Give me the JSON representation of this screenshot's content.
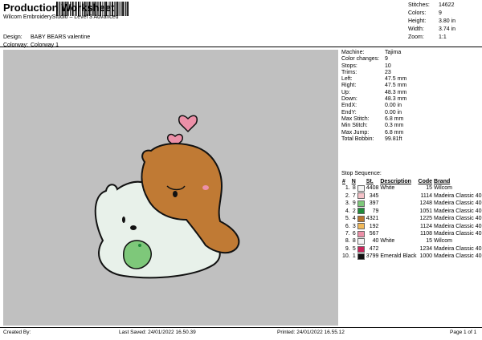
{
  "header": {
    "title": "Production Worksheet",
    "subtitle": "Wilcom EmbroideryStudio – Level 3 Advanced"
  },
  "stats": [
    {
      "label": "Stitches:",
      "value": "14622"
    },
    {
      "label": "Colors:",
      "value": "9"
    },
    {
      "label": "Height:",
      "value": "3.80 in"
    },
    {
      "label": "Width:",
      "value": "3.74 in"
    },
    {
      "label": "Zoom:",
      "value": "1:1"
    }
  ],
  "meta": [
    {
      "label": "Design:",
      "value": "BABY BEARS valentine"
    },
    {
      "label": "Colorway:",
      "value": "Colorway 1"
    }
  ],
  "machine_info": [
    {
      "label": "Machine:",
      "value": "Tajima"
    },
    {
      "label": "Color changes:",
      "value": "9"
    },
    {
      "label": "Stops:",
      "value": "10"
    },
    {
      "label": "Trims:",
      "value": "23"
    },
    {
      "label": "Left:",
      "value": "47.5 mm"
    },
    {
      "label": "Right:",
      "value": "47.5 mm"
    },
    {
      "label": "Up:",
      "value": "48.3 mm"
    },
    {
      "label": "Down:",
      "value": "48.3 mm"
    },
    {
      "label": "EndX:",
      "value": "0.00 in"
    },
    {
      "label": "EndY:",
      "value": "0.00 in"
    },
    {
      "label": "Max Stitch:",
      "value": "6.8 mm"
    },
    {
      "label": "Min Stitch:",
      "value": "0.3 mm"
    },
    {
      "label": "Max Jump:",
      "value": "6.8 mm"
    },
    {
      "label": "Total Bobbin:",
      "value": "99.81ft"
    }
  ],
  "sequence": {
    "heading": "Stop Sequence:",
    "columns": [
      "#",
      "N",
      "St.",
      "Description",
      "Code",
      "Brand"
    ],
    "rows": [
      {
        "num": "1.",
        "n": "8",
        "color": "#f4f4f4",
        "st": "4408",
        "desc": "White",
        "code": "15",
        "brand": "Wilcom"
      },
      {
        "num": "2.",
        "n": "7",
        "color": "#f4c2c8",
        "st": "345",
        "desc": "",
        "code": "1114",
        "brand": "Madeira Classic 40"
      },
      {
        "num": "3.",
        "n": "9",
        "color": "#7ec87a",
        "st": "397",
        "desc": "",
        "code": "1248",
        "brand": "Madeira Classic 40"
      },
      {
        "num": "4.",
        "n": "2",
        "color": "#1f8a3a",
        "st": "79",
        "desc": "",
        "code": "1051",
        "brand": "Madeira Classic 40"
      },
      {
        "num": "5.",
        "n": "4",
        "color": "#b8742e",
        "st": "4321",
        "desc": "",
        "code": "1225",
        "brand": "Madeira Classic 40"
      },
      {
        "num": "6.",
        "n": "3",
        "color": "#f0b85a",
        "st": "192",
        "desc": "",
        "code": "1124",
        "brand": "Madeira Classic 40"
      },
      {
        "num": "7.",
        "n": "6",
        "color": "#ec90a8",
        "st": "567",
        "desc": "",
        "code": "1108",
        "brand": "Madeira Classic 40"
      },
      {
        "num": "8.",
        "n": "8",
        "color": "#f4f4f4",
        "st": "40",
        "desc": "White",
        "code": "15",
        "brand": "Wilcom"
      },
      {
        "num": "9.",
        "n": "5",
        "color": "#c8245a",
        "st": "472",
        "desc": "",
        "code": "1234",
        "brand": "Madeira Classic 40"
      },
      {
        "num": "10.",
        "n": "1",
        "color": "#111111",
        "st": "3799",
        "desc": "Emerald Black",
        "code": "1000",
        "brand": "Madeira Classic 40"
      }
    ]
  },
  "footer": {
    "created_by": "Created By:",
    "last_saved": "Last Saved: 24/01/2022 16.50.39",
    "printed": "Printed: 24/01/2022 16.55.12",
    "page": "Page 1 of 1"
  }
}
